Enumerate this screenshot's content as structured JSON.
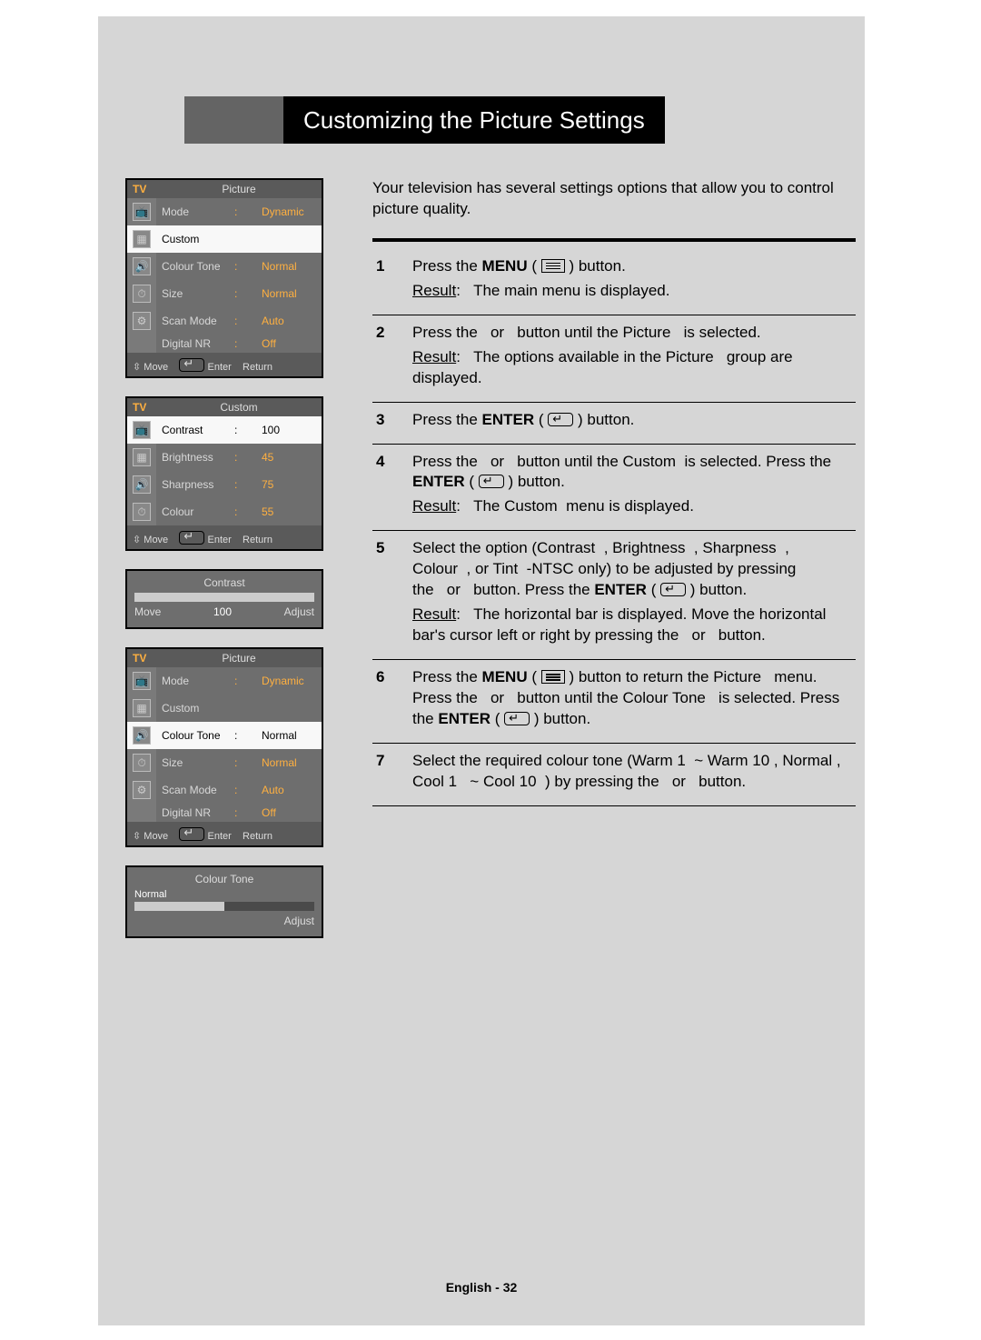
{
  "title": "Customizing the Picture Settings",
  "intro": "Your television has several settings options that allow you to control picture quality.",
  "footer": "English - 32",
  "result_label": "Result",
  "steps": [
    {
      "n": "1",
      "lines": [
        "Press the <b>MENU</b> ( <span class='menu-icon'></span> ) button."
      ],
      "result": "The main menu is displayed."
    },
    {
      "n": "2",
      "lines": [
        "Press the&nbsp;&nbsp;&nbsp;or&nbsp;&nbsp;&nbsp;button until the Picture&nbsp;&nbsp;&nbsp;is selected."
      ],
      "result": "The options available in the Picture&nbsp;&nbsp;&nbsp;group are displayed."
    },
    {
      "n": "3",
      "lines": [
        "Press the <b>ENTER</b> ( <span class='enter-icon'></span> ) button."
      ]
    },
    {
      "n": "4",
      "lines": [
        "Press the&nbsp;&nbsp;&nbsp;or&nbsp;&nbsp;&nbsp;button until the Custom&nbsp; is selected. Press the <b>ENTER</b> ( <span class='enter-icon'></span> ) button."
      ],
      "result": "The Custom&nbsp; menu is displayed."
    },
    {
      "n": "5",
      "lines": [
        "Select the option (Contrast&nbsp;&nbsp;, Brightness&nbsp;&nbsp;, Sharpness&nbsp;&nbsp;, Colour&nbsp;&nbsp;, or Tint&nbsp; -NTSC only) to be adjusted by pressing the&nbsp;&nbsp;&nbsp;or&nbsp;&nbsp;&nbsp;button. Press the <b>ENTER</b> ( <span class='enter-icon'></span> ) button."
      ],
      "result": "The horizontal bar is displayed. Move the horizontal bar's cursor left or right by pressing the&nbsp;&nbsp;&nbsp;or&nbsp;&nbsp;&nbsp;button."
    },
    {
      "n": "6",
      "lines": [
        "Press the <b>MENU</b> ( <span class='menu-icon'></span> ) button to return the Picture&nbsp;&nbsp;&nbsp;menu. Press the&nbsp;&nbsp;&nbsp;or&nbsp;&nbsp;&nbsp;button until the Colour Tone&nbsp;&nbsp;&nbsp;is selected. Press the <b>ENTER</b> ( <span class='enter-icon'></span> ) button."
      ]
    },
    {
      "n": "7",
      "lines": [
        "Select the required colour tone (Warm 1&nbsp;&nbsp;~ Warm 10 , Normal , Cool 1&nbsp;&nbsp;&nbsp;~ Cool 10&nbsp;&nbsp;) by pressing the&nbsp;&nbsp;&nbsp;or&nbsp;&nbsp;&nbsp;button."
      ]
    }
  ],
  "osd1": {
    "tv": "TV",
    "title": "Picture",
    "rows": [
      {
        "l": "Mode",
        "c": ":",
        "v": "Dynamic",
        "hl": false
      },
      {
        "l": "Custom",
        "c": "",
        "v": "",
        "hl": true
      },
      {
        "l": "Colour Tone",
        "c": ":",
        "v": "Normal",
        "hl": false
      },
      {
        "l": "Size",
        "c": ":",
        "v": "Normal",
        "hl": false
      },
      {
        "l": "Scan Mode",
        "c": ":",
        "v": "Auto",
        "hl": false
      },
      {
        "l": "Digital NR",
        "c": ":",
        "v": "Off",
        "hl": false
      }
    ],
    "foot": {
      "move": "Move",
      "enter": "Enter",
      "ret": "Return"
    }
  },
  "osd2": {
    "tv": "TV",
    "title": "Custom",
    "rows": [
      {
        "l": "Contrast",
        "c": ":",
        "v": "100",
        "hl": true
      },
      {
        "l": "Brightness",
        "c": ":",
        "v": "45",
        "hl": false
      },
      {
        "l": "Sharpness",
        "c": ":",
        "v": "75",
        "hl": false
      },
      {
        "l": "Colour",
        "c": ":",
        "v": "55",
        "hl": false
      }
    ],
    "foot": {
      "move": "Move",
      "enter": "Enter",
      "ret": "Return"
    }
  },
  "osd3": {
    "title": "Contrast",
    "value": "100",
    "percent": 100,
    "left": "Move",
    "right": "Adjust"
  },
  "osd4": {
    "tv": "TV",
    "title": "Picture",
    "rows": [
      {
        "l": "Mode",
        "c": ":",
        "v": "Dynamic",
        "hl": false
      },
      {
        "l": "Custom",
        "c": "",
        "v": "",
        "hl": false
      },
      {
        "l": "Colour Tone",
        "c": ":",
        "v": "Normal",
        "hl": true
      },
      {
        "l": "Size",
        "c": ":",
        "v": "Normal",
        "hl": false
      },
      {
        "l": "Scan Mode",
        "c": ":",
        "v": "Auto",
        "hl": false
      },
      {
        "l": "Digital NR",
        "c": ":",
        "v": "Off",
        "hl": false
      }
    ],
    "foot": {
      "move": "Move",
      "enter": "Enter",
      "ret": "Return"
    }
  },
  "osd5": {
    "title": "Colour Tone",
    "label": "Normal",
    "percent": 50,
    "right": "Adjust"
  }
}
